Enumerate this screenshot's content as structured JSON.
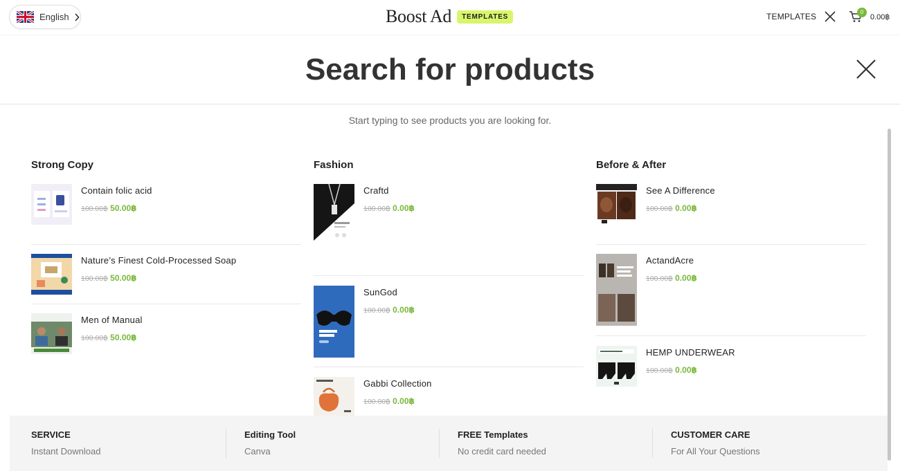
{
  "header": {
    "language": "English",
    "logo_text": "Boost Ad",
    "logo_badge": "TEMPLATES",
    "nav_templates": "TEMPLATES",
    "cart_count": "0",
    "cart_total": "0.00฿"
  },
  "search": {
    "placeholder": "Search for products",
    "hint": "Start typing to see products you are looking for."
  },
  "columns": [
    {
      "title": "Strong Copy",
      "items": [
        {
          "name": "Contain folic acid",
          "old_price": "100.00฿",
          "price": "50.00฿"
        },
        {
          "name": "Nature’s Finest Cold-Processed Soap",
          "old_price": "100.00฿",
          "price": "50.00฿"
        },
        {
          "name": "Men of Manual",
          "old_price": "100.00฿",
          "price": "50.00฿"
        }
      ]
    },
    {
      "title": "Fashion",
      "items": [
        {
          "name": "Craftd",
          "old_price": "100.00฿",
          "price": "0.00฿"
        },
        {
          "name": "SunGod",
          "old_price": "100.00฿",
          "price": "0.00฿"
        },
        {
          "name": "Gabbi Collection",
          "old_price": "100.00฿",
          "price": "0.00฿"
        }
      ]
    },
    {
      "title": "Before & After",
      "items": [
        {
          "name": "See A Difference",
          "old_price": "100.00฿",
          "price": "0.00฿"
        },
        {
          "name": "ActandAcre",
          "old_price": "100.00฿",
          "price": "0.00฿"
        },
        {
          "name": "HEMP UNDERWEAR",
          "old_price": "100.00฿",
          "price": "0.00฿"
        }
      ]
    }
  ],
  "footer": [
    {
      "title": "SERVICE",
      "text": "Instant Download"
    },
    {
      "title": "Editing Tool",
      "text": "Canva"
    },
    {
      "title": "FREE Templates",
      "text": "No credit card needed"
    },
    {
      "title": "CUSTOMER CARE",
      "text": "For All Your Questions"
    }
  ],
  "colors": {
    "accent_green": "#7ab83a",
    "badge_lime": "#d9f56b"
  },
  "icons": [
    "uk-flag-icon",
    "chevron-right-icon",
    "close-icon",
    "cart-icon"
  ]
}
